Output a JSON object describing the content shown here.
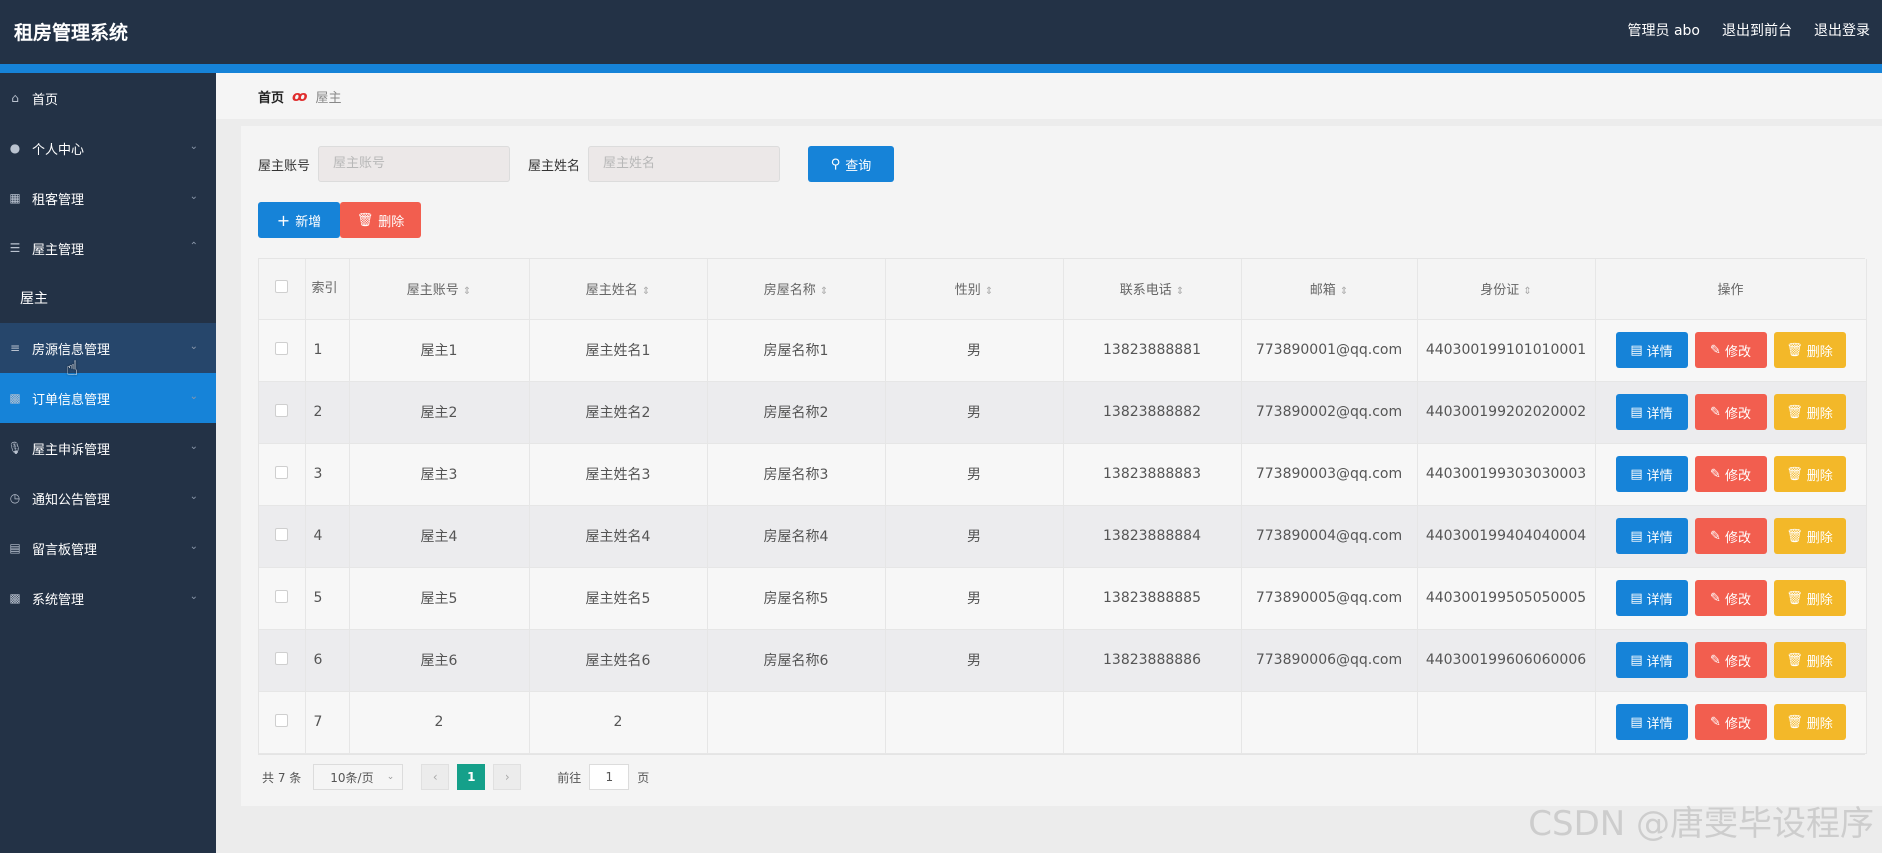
{
  "header": {
    "title": "租房管理系统",
    "admin": "管理员 abo",
    "back_front": "退出到前台",
    "logout": "退出登录"
  },
  "sidebar": {
    "items": [
      {
        "label": "首页",
        "icon": "home-icon"
      },
      {
        "label": "个人中心",
        "icon": "user-icon"
      },
      {
        "label": "租客管理",
        "icon": "grid-icon"
      },
      {
        "label": "屋主管理",
        "icon": "sliders-icon"
      },
      {
        "label": "屋主",
        "icon": ""
      },
      {
        "label": "房源信息管理",
        "icon": "list-icon"
      },
      {
        "label": "订单信息管理",
        "icon": "chart-icon"
      },
      {
        "label": "屋主申诉管理",
        "icon": "mic-icon"
      },
      {
        "label": "通知公告管理",
        "icon": "clock-icon"
      },
      {
        "label": "留言板管理",
        "icon": "board-icon"
      },
      {
        "label": "系统管理",
        "icon": "chart-icon"
      }
    ]
  },
  "breadcrumb": {
    "home": "首页",
    "current": "屋主"
  },
  "search": {
    "account_label": "屋主账号",
    "account_placeholder": "屋主账号",
    "name_label": "屋主姓名",
    "name_placeholder": "屋主姓名",
    "query_label": "查询"
  },
  "toolbar": {
    "add_label": "新增",
    "delete_label": "删除"
  },
  "table": {
    "headers": {
      "index": "索引",
      "account": "屋主账号",
      "name": "屋主姓名",
      "house": "房屋名称",
      "gender": "性别",
      "phone": "联系电话",
      "email": "邮箱",
      "idcard": "身份证",
      "ops": "操作"
    },
    "op_labels": {
      "detail": "详情",
      "edit": "修改",
      "remove": "删除"
    },
    "rows": [
      {
        "index": "1",
        "account": "屋主1",
        "name": "屋主姓名1",
        "house": "房屋名称1",
        "gender": "男",
        "phone": "13823888881",
        "email": "773890001@qq.com",
        "idcard": "440300199101010001"
      },
      {
        "index": "2",
        "account": "屋主2",
        "name": "屋主姓名2",
        "house": "房屋名称2",
        "gender": "男",
        "phone": "13823888882",
        "email": "773890002@qq.com",
        "idcard": "440300199202020002"
      },
      {
        "index": "3",
        "account": "屋主3",
        "name": "屋主姓名3",
        "house": "房屋名称3",
        "gender": "男",
        "phone": "13823888883",
        "email": "773890003@qq.com",
        "idcard": "440300199303030003"
      },
      {
        "index": "4",
        "account": "屋主4",
        "name": "屋主姓名4",
        "house": "房屋名称4",
        "gender": "男",
        "phone": "13823888884",
        "email": "773890004@qq.com",
        "idcard": "440300199404040004"
      },
      {
        "index": "5",
        "account": "屋主5",
        "name": "屋主姓名5",
        "house": "房屋名称5",
        "gender": "男",
        "phone": "13823888885",
        "email": "773890005@qq.com",
        "idcard": "440300199505050005"
      },
      {
        "index": "6",
        "account": "屋主6",
        "name": "屋主姓名6",
        "house": "房屋名称6",
        "gender": "男",
        "phone": "13823888886",
        "email": "773890006@qq.com",
        "idcard": "440300199606060006"
      },
      {
        "index": "7",
        "account": "2",
        "name": "2",
        "house": "",
        "gender": "",
        "phone": "",
        "email": "",
        "idcard": ""
      }
    ]
  },
  "pagination": {
    "total": "共 7 条",
    "page_size": "10条/页",
    "current_page": "1",
    "goto_label": "前往",
    "goto_value": "1",
    "page_suffix": "页"
  },
  "watermark": "CSDN @唐雯毕设程序",
  "colors": {
    "header_bg": "#233246",
    "accent_blue": "#1683d8",
    "danger_red": "#f25e4f",
    "warning_yellow": "#f3b829",
    "page_active": "#15a08a"
  }
}
